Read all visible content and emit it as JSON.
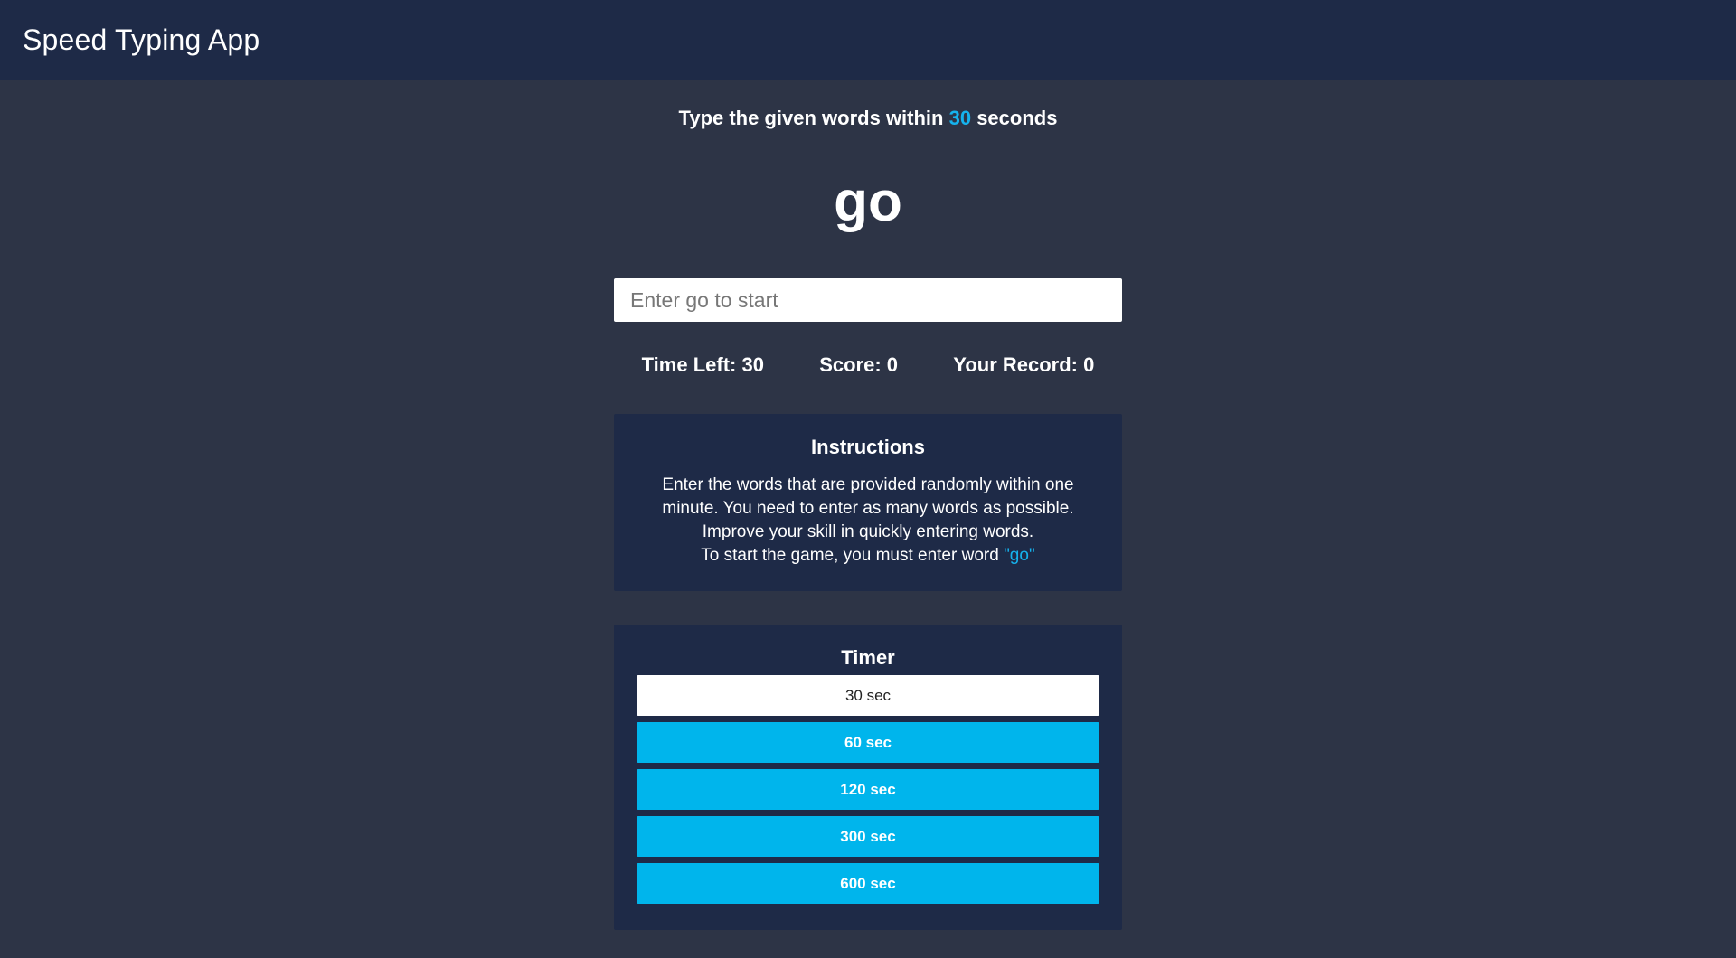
{
  "app": {
    "title": "Speed Typing App"
  },
  "theme": {
    "background": "#2d3446",
    "navbar": "#1e2a47",
    "accent": "#15b2ed",
    "button": "#00b5ec"
  },
  "subtitle": {
    "prefix": "Type the given words within ",
    "seconds": "30",
    "suffix": " seconds"
  },
  "game": {
    "current_word": "go",
    "input_value": "",
    "input_placeholder": "Enter go to start"
  },
  "stats": {
    "time_left": "Time Left: 30",
    "score": "Score: 0",
    "record": "Your Record: 0"
  },
  "instructions": {
    "heading": "Instructions",
    "line1": "Enter the words that are provided randomly within one",
    "line2": "minute. You need to enter as many words as possible.",
    "line3": "Improve your skill in quickly entering words.",
    "line4_prefix": "To start the game, you must enter word ",
    "line4_word": "\"go\""
  },
  "timer": {
    "heading": "Timer",
    "options": [
      {
        "label": "30 sec",
        "selected": true
      },
      {
        "label": "60 sec",
        "selected": false
      },
      {
        "label": "120 sec",
        "selected": false
      },
      {
        "label": "300 sec",
        "selected": false
      },
      {
        "label": "600 sec",
        "selected": false
      }
    ]
  }
}
